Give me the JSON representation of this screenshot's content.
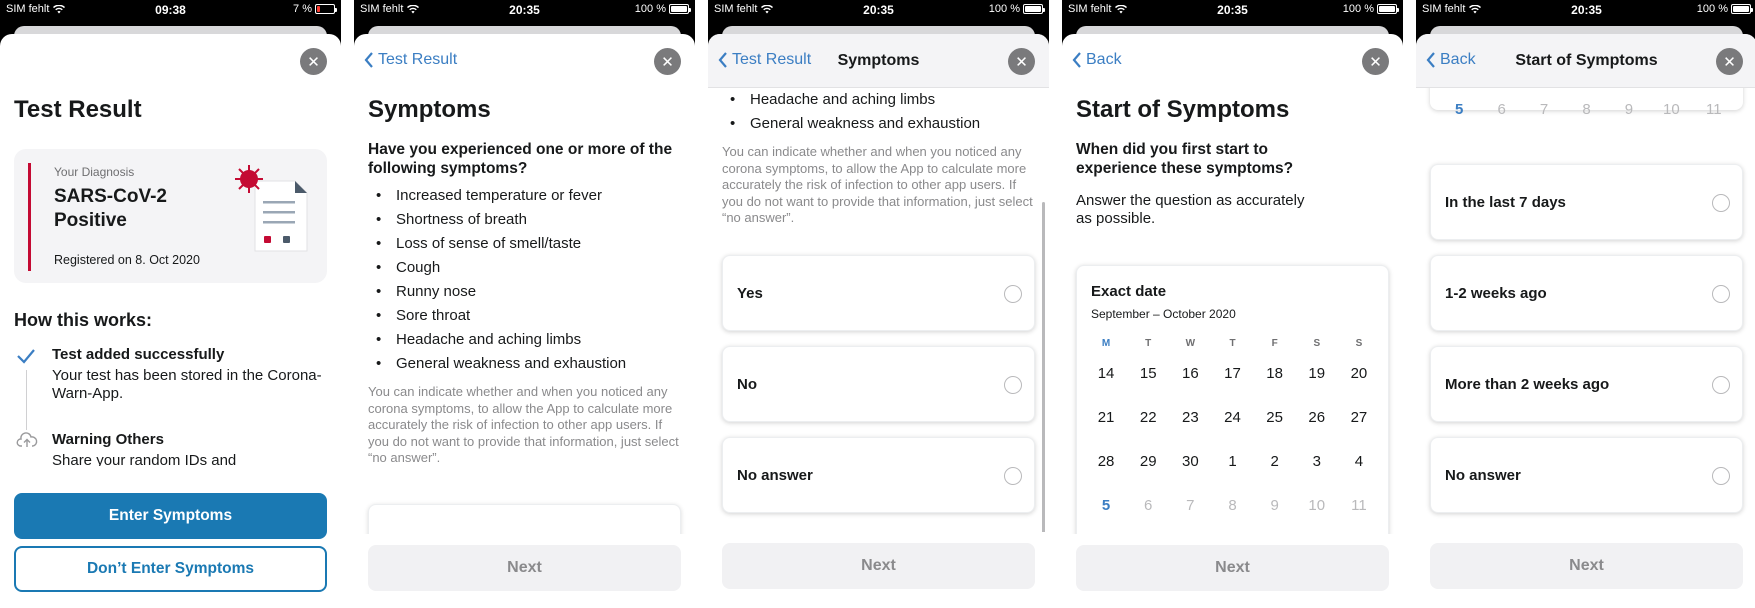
{
  "screens": [
    {
      "status": {
        "carrier": "SIM fehlt",
        "time": "09:38",
        "battery": "7 %"
      },
      "close_glyph": "✕",
      "title": "Test Result",
      "diagnosis": {
        "label": "Your Diagnosis",
        "value": "SARS-CoV-2 Positive",
        "registered": "Registered on 8. Oct 2020"
      },
      "how_title": "How this works:",
      "steps": [
        {
          "title": "Test added successfully",
          "body": "Your test has been stored in the Corona-Warn-App."
        },
        {
          "title": "Warning Others",
          "body": "Share your random IDs and"
        }
      ],
      "primary_button": "Enter Symptoms",
      "secondary_button": "Don’t Enter Symptoms"
    },
    {
      "status": {
        "carrier": "SIM fehlt",
        "time": "20:35",
        "battery": "100 %"
      },
      "close_glyph": "✕",
      "back_label": "Test Result",
      "title": "Symptoms",
      "question": "Have you experienced one or more of the following symptoms?",
      "symptoms": [
        "Increased temperature or fever",
        "Shortness of breath",
        "Loss of sense of smell/taste",
        "Cough",
        "Runny nose",
        "Sore throat",
        "Headache and aching limbs",
        "General weakness and exhaustion"
      ],
      "info": "You can indicate whether and when you noticed any corona symptoms, to allow the App to calculate more accurately the risk of infection to other app users. If you do not want to provide that information, just select “no answer”.",
      "next": "Next"
    },
    {
      "status": {
        "carrier": "SIM fehlt",
        "time": "20:35",
        "battery": "100 %"
      },
      "close_glyph": "✕",
      "back_label": "Test Result",
      "nav_title": "Symptoms",
      "symptoms_tail": [
        "Headache and aching limbs",
        "General weakness and exhaustion"
      ],
      "info": "You can indicate whether and when you noticed any corona symptoms, to allow the App to calculate more accurately the risk of infection to other app users. If you do not want to provide that information, just select “no answer”.",
      "options": [
        "Yes",
        "No",
        "No answer"
      ],
      "next": "Next"
    },
    {
      "status": {
        "carrier": "SIM fehlt",
        "time": "20:35",
        "battery": "100 %"
      },
      "close_glyph": "✕",
      "back_label": "Back",
      "title": "Start of Symptoms",
      "question": "When did you first start to experience these symptoms?",
      "hint": "Answer the question as accurately as possible.",
      "calendar": {
        "title": "Exact date",
        "range": "September – October 2020",
        "weekdays": [
          "M",
          "T",
          "W",
          "T",
          "F",
          "S",
          "S"
        ],
        "weeks": [
          [
            "14",
            "15",
            "16",
            "17",
            "18",
            "19",
            "20"
          ],
          [
            "21",
            "22",
            "23",
            "24",
            "25",
            "26",
            "27"
          ],
          [
            "28",
            "29",
            "30",
            "1",
            "2",
            "3",
            "4"
          ],
          [
            "5",
            "6",
            "7",
            "8",
            "9",
            "10",
            "11"
          ]
        ]
      },
      "next": "Next"
    },
    {
      "status": {
        "carrier": "SIM fehlt",
        "time": "20:35",
        "battery": "100 %"
      },
      "close_glyph": "✕",
      "back_label": "Back",
      "nav_title": "Start of Symptoms",
      "calendar_tail": [
        "5",
        "6",
        "7",
        "8",
        "9",
        "10",
        "11"
      ],
      "options": [
        "In the last 7 days",
        "1-2 weeks ago",
        "More than 2 weeks ago",
        "No answer"
      ],
      "next": "Next"
    }
  ],
  "colors": {
    "accent": "#1a79b3",
    "link": "#3b7ec3",
    "diagnosis_bar": "#c40a33",
    "virus": "#c40a33"
  }
}
